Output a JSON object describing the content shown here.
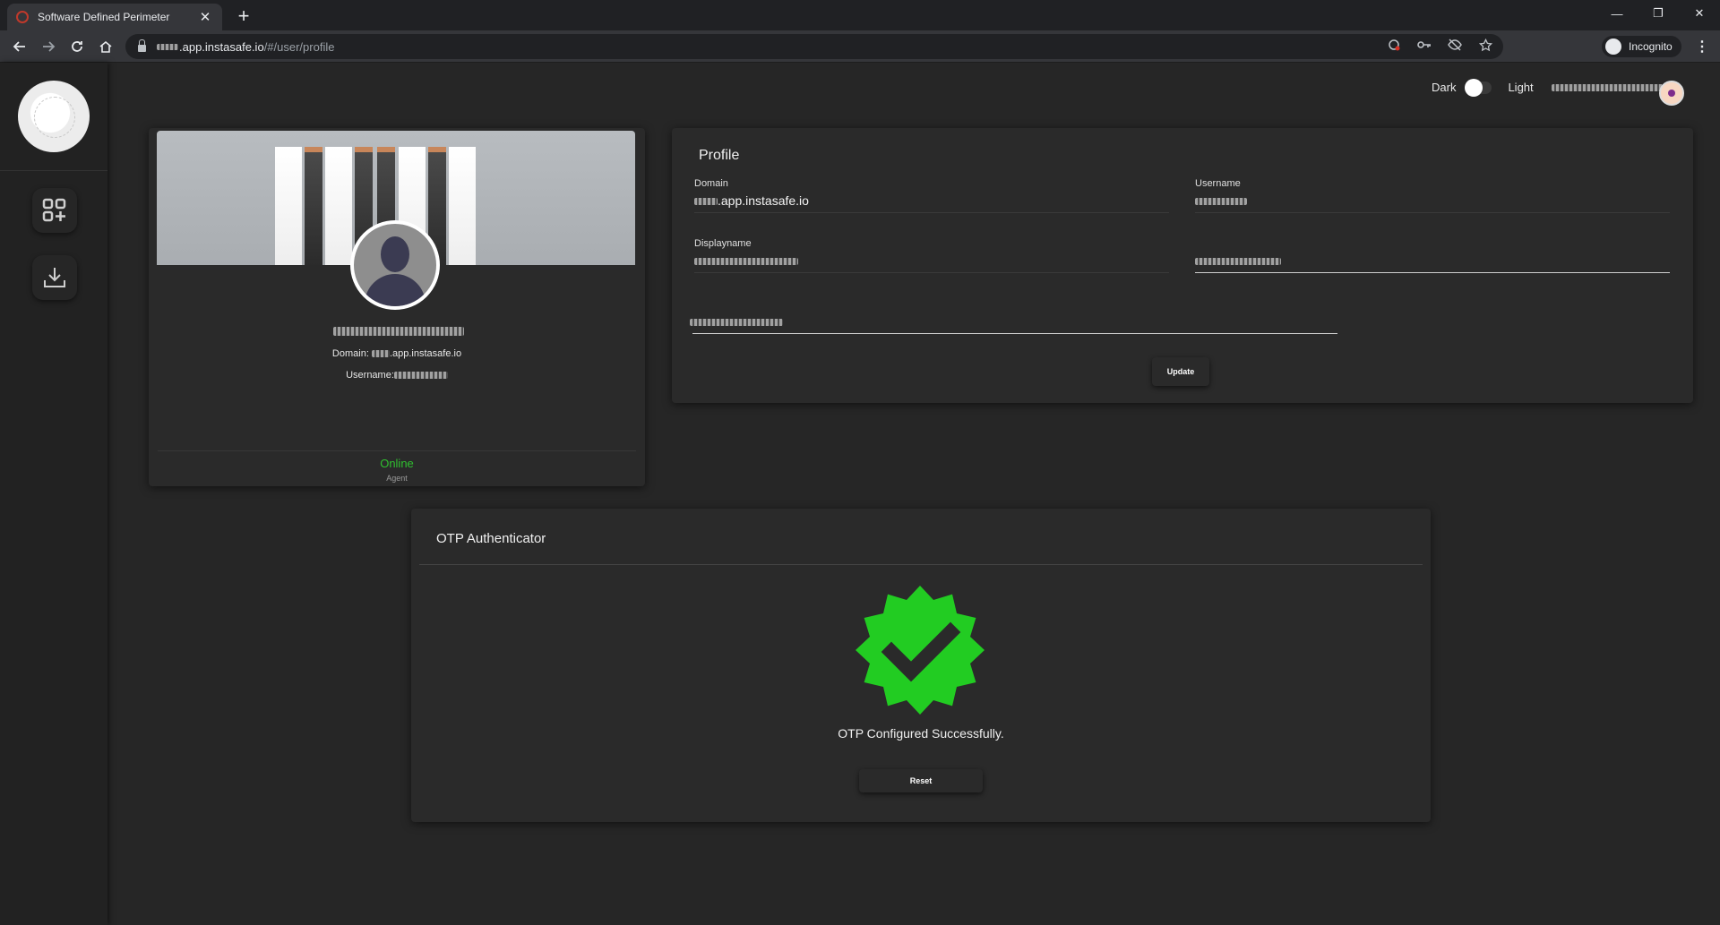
{
  "browser": {
    "tab_title": "Software Defined Perimeter",
    "tab_close": "✕",
    "new_tab": "+",
    "url_host": ".app.instasafe.io",
    "url_path": "/#/user/profile",
    "incognito_label": "Incognito",
    "window": {
      "minimize": "—",
      "restore": "❐",
      "close": "✕"
    }
  },
  "theme_toggle": {
    "dark_label": "Dark",
    "light_label": "Light"
  },
  "profile_card": {
    "domain_label": "Domain:",
    "domain_value": ".app.instasafe.io",
    "username_label": "Username:",
    "status": "Online",
    "status_sub": "Agent",
    "status_color": "#2fc02f"
  },
  "profile_form": {
    "title": "Profile",
    "domain_label": "Domain",
    "domain_value": ".app.instasafe.io",
    "username_label": "Username",
    "displayname_label": "Displayname",
    "update_button": "Update"
  },
  "otp": {
    "title": "OTP Authenticator",
    "message": "OTP Configured Successfully.",
    "reset_button": "Reset",
    "badge_color": "#22cc22",
    "badge_icon": "verified-check-icon"
  }
}
